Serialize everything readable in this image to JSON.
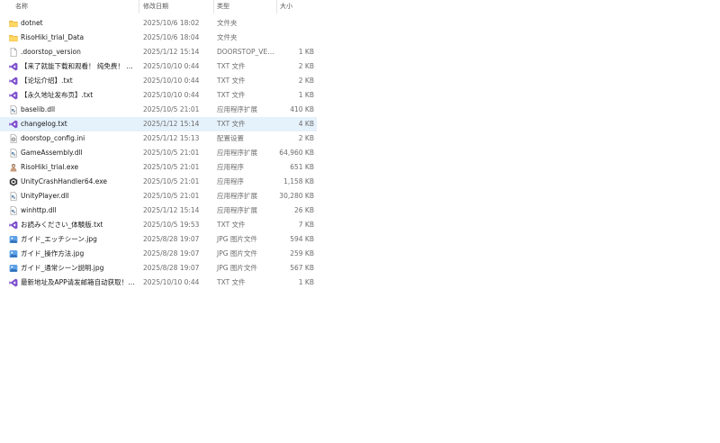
{
  "columns": {
    "name": "名称",
    "date": "修改日期",
    "type": "类型",
    "size": "大小"
  },
  "files": [
    {
      "name": "dotnet",
      "date": "2025/10/6 18:02",
      "type": "文件夹",
      "size": "",
      "icon": "folder-icon"
    },
    {
      "name": "RisoHiki_trial_Data",
      "date": "2025/10/6 18:04",
      "type": "文件夹",
      "size": "",
      "icon": "folder-icon"
    },
    {
      "name": ".doorstop_version",
      "date": "2025/1/12 15:14",
      "type": "DOORSTOP_VER...",
      "size": "1 KB",
      "icon": "file-icon"
    },
    {
      "name": "【来了就能下载和观看！ 纯免费！ 】.txt",
      "date": "2025/10/10 0:44",
      "type": "TXT 文件",
      "size": "2 KB",
      "icon": "vs-icon"
    },
    {
      "name": "【论坛介绍】.txt",
      "date": "2025/10/10 0:44",
      "type": "TXT 文件",
      "size": "2 KB",
      "icon": "vs-icon"
    },
    {
      "name": "【永久地址发布页】.txt",
      "date": "2025/10/10 0:44",
      "type": "TXT 文件",
      "size": "1 KB",
      "icon": "vs-icon"
    },
    {
      "name": "baselib.dll",
      "date": "2025/10/5 21:01",
      "type": "应用程序扩展",
      "size": "410 KB",
      "icon": "dll-icon"
    },
    {
      "name": "changelog.txt",
      "date": "2025/1/12 15:14",
      "type": "TXT 文件",
      "size": "4 KB",
      "icon": "vs-icon"
    },
    {
      "name": "doorstop_config.ini",
      "date": "2025/1/12 15:13",
      "type": "配置设置",
      "size": "2 KB",
      "icon": "ini-icon"
    },
    {
      "name": "GameAssembly.dll",
      "date": "2025/10/5 21:01",
      "type": "应用程序扩展",
      "size": "64,960 KB",
      "icon": "dll-icon"
    },
    {
      "name": "RisoHiki_trial.exe",
      "date": "2025/10/5 21:01",
      "type": "应用程序",
      "size": "651 KB",
      "icon": "app-icon"
    },
    {
      "name": "UnityCrashHandler64.exe",
      "date": "2025/10/5 21:01",
      "type": "应用程序",
      "size": "1,158 KB",
      "icon": "unity-icon"
    },
    {
      "name": "UnityPlayer.dll",
      "date": "2025/10/5 21:01",
      "type": "应用程序扩展",
      "size": "30,280 KB",
      "icon": "dll-icon"
    },
    {
      "name": "winhttp.dll",
      "date": "2025/1/12 15:14",
      "type": "应用程序扩展",
      "size": "26 KB",
      "icon": "dll-icon"
    },
    {
      "name": "お読みください_体験版.txt",
      "date": "2025/10/5 19:53",
      "type": "TXT 文件",
      "size": "7 KB",
      "icon": "vs-icon"
    },
    {
      "name": "ガイド_エッチシーン.jpg",
      "date": "2025/8/28 19:07",
      "type": "JPG 图片文件",
      "size": "594 KB",
      "icon": "image-icon"
    },
    {
      "name": "ガイド_操作方法.jpg",
      "date": "2025/8/28 19:07",
      "type": "JPG 图片文件",
      "size": "259 KB",
      "icon": "image-icon"
    },
    {
      "name": "ガイド_通常シーン説明.jpg",
      "date": "2025/8/28 19:07",
      "type": "JPG 图片文件",
      "size": "567 KB",
      "icon": "image-icon"
    },
    {
      "name": "最新地址及APP请发邮箱自动获取！！！....",
      "date": "2025/10/10 0:44",
      "type": "TXT 文件",
      "size": "1 KB",
      "icon": "vs-icon"
    }
  ],
  "selected_file": "changelog.txt",
  "colors": {
    "selection": "#e5f1fb",
    "folder": "#f6c344",
    "vs_purple": "#7c4dcc"
  }
}
